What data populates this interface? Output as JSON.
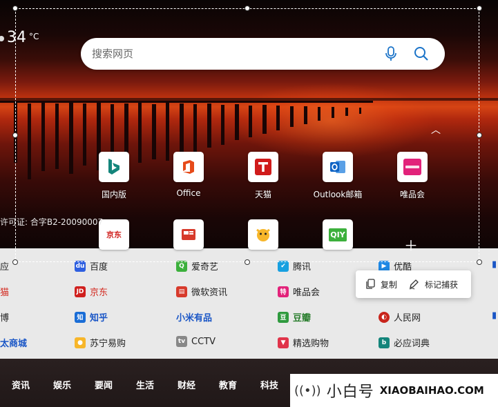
{
  "weather": {
    "temp": "34",
    "unit": "°C"
  },
  "search": {
    "placeholder": "搜索网页"
  },
  "shortcuts": [
    {
      "label": "国内版",
      "icon": "bing-icon"
    },
    {
      "label": "Office",
      "icon": "office-icon"
    },
    {
      "label": "天猫",
      "icon": "tmall-icon"
    },
    {
      "label": "Outlook邮箱",
      "icon": "outlook-icon"
    },
    {
      "label": "唯品会",
      "icon": "vip-icon"
    }
  ],
  "shortcuts_row2": [
    {
      "icon": "jd-icon",
      "text": "京东"
    },
    {
      "icon": "msn-icon"
    },
    {
      "icon": "suning-icon"
    },
    {
      "icon": "iqiyi-icon",
      "text": "QIY"
    }
  ],
  "license": "许可证: 合字B2-20090007",
  "links": {
    "row1": [
      "应",
      "百度",
      "爱奇艺",
      "腾讯",
      "优酷"
    ],
    "row2": [
      "猫",
      "京东",
      "微软资讯",
      "唯品会"
    ],
    "row3": [
      "博",
      "知乎",
      "小米有品",
      "豆瓣",
      "人民网"
    ],
    "row4": [
      "太商城",
      "苏宁易购",
      "CCTV",
      "精选购物",
      "必应词典"
    ]
  },
  "menu": {
    "copy": "复制",
    "mark": "标记捕获"
  },
  "nav": [
    "资讯",
    "娱乐",
    "要闻",
    "生活",
    "财经",
    "教育",
    "科技"
  ],
  "brand": {
    "cn": "小白号",
    "en": "XIAOBAIHAO.COM"
  }
}
